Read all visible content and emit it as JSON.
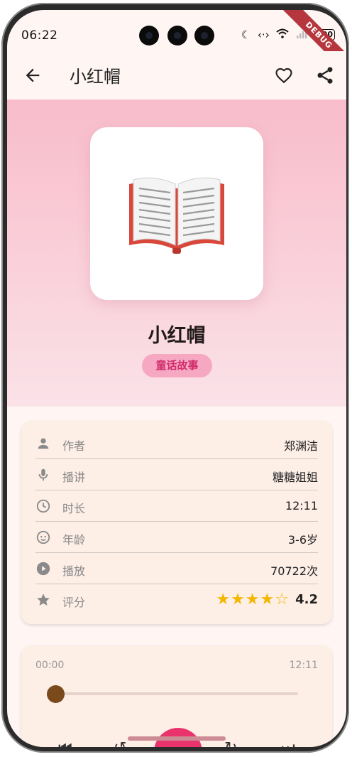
{
  "status_bar": {
    "time": "06:22",
    "battery": "100",
    "debug_banner": "DEBUG",
    "icons": [
      "moon-icon",
      "data-transfer-icon",
      "wifi-icon",
      "signal-icon",
      "battery-icon"
    ]
  },
  "app_bar": {
    "title": "小红帽",
    "icons": [
      "back-arrow-icon",
      "heart-outline-icon",
      "share-icon"
    ]
  },
  "hero": {
    "cover_icon": "open-book-icon",
    "title": "小红帽",
    "category": "童话故事",
    "colors": {
      "gradient_top": "#f8bcca",
      "gradient_bottom": "#fbe2e8",
      "tag_bg": "#f6a8c2",
      "tag_text": "#d12c6a"
    }
  },
  "info": {
    "rows": [
      {
        "icon": "person-icon",
        "label": "作者",
        "value": "郑渊洁"
      },
      {
        "icon": "microphone-icon",
        "label": "播讲",
        "value": "糖糖姐姐"
      },
      {
        "icon": "clock-icon",
        "label": "时长",
        "value": "12:11"
      },
      {
        "icon": "face-icon",
        "label": "年龄",
        "value": "3-6岁"
      },
      {
        "icon": "play-circle-icon",
        "label": "播放",
        "value": "70722次"
      },
      {
        "icon": "star-icon",
        "label": "评分",
        "value": "4.2"
      }
    ],
    "rating_stars": 4
  },
  "player": {
    "current_time": "00:00",
    "total_time": "12:11",
    "progress": 0,
    "accent": "#e9336d",
    "knob_color": "#7a4a1c"
  }
}
